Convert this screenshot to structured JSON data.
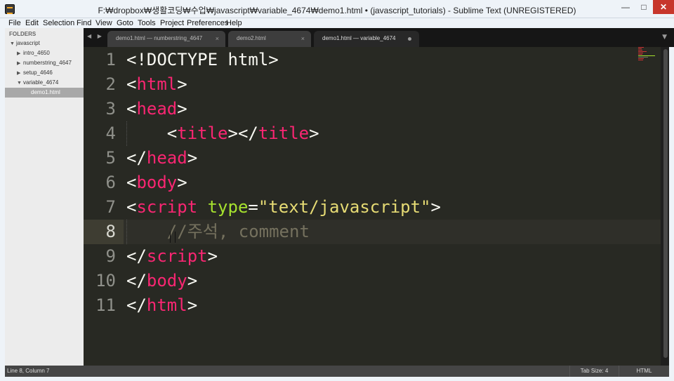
{
  "window": {
    "title": "F:₩dropbox₩생활코딩₩수업₩javascript₩variable_4674₩demo1.html • (javascript_tutorials) - Sublime Text (UNREGISTERED)",
    "minimize": "—",
    "maximize": "□",
    "close": "✕"
  },
  "menu": [
    "File",
    "Edit",
    "Selection",
    "Find",
    "View",
    "Goto",
    "Tools",
    "Project",
    "Preferences",
    "Help"
  ],
  "sidebar": {
    "header": "FOLDERS",
    "items": [
      {
        "label": "javascript",
        "expanded": true
      },
      {
        "label": "intro_4650",
        "expanded": false
      },
      {
        "label": "numberstring_4647",
        "expanded": false
      },
      {
        "label": "setup_4646",
        "expanded": false
      },
      {
        "label": "variable_4674",
        "expanded": true
      },
      {
        "label": "demo1.html",
        "selected": true
      }
    ]
  },
  "tabs": [
    {
      "label": "demo1.html — numberstring_4647",
      "active": false,
      "close": "×"
    },
    {
      "label": "demo2.html",
      "active": false,
      "close": "×"
    },
    {
      "label": "demo1.html — variable_4674",
      "active": true,
      "modified": true
    }
  ],
  "tab_nav": "◀ ▶",
  "tab_dropdown": "▼",
  "editor": {
    "current_line": 8,
    "lines": [
      {
        "n": "1",
        "tokens": [
          {
            "t": "<!DOCTYPE html>",
            "c": "plain"
          }
        ]
      },
      {
        "n": "2",
        "tokens": [
          {
            "t": "<",
            "c": "plain"
          },
          {
            "t": "html",
            "c": "tag"
          },
          {
            "t": ">",
            "c": "plain"
          }
        ]
      },
      {
        "n": "3",
        "tokens": [
          {
            "t": "<",
            "c": "plain"
          },
          {
            "t": "head",
            "c": "tag"
          },
          {
            "t": ">",
            "c": "plain"
          }
        ]
      },
      {
        "n": "4",
        "tokens": [
          {
            "t": "    <",
            "c": "plain"
          },
          {
            "t": "title",
            "c": "tag"
          },
          {
            "t": "></",
            "c": "plain"
          },
          {
            "t": "title",
            "c": "tag"
          },
          {
            "t": ">",
            "c": "plain"
          }
        ]
      },
      {
        "n": "5",
        "tokens": [
          {
            "t": "</",
            "c": "plain"
          },
          {
            "t": "head",
            "c": "tag"
          },
          {
            "t": ">",
            "c": "plain"
          }
        ]
      },
      {
        "n": "6",
        "tokens": [
          {
            "t": "<",
            "c": "plain"
          },
          {
            "t": "body",
            "c": "tag"
          },
          {
            "t": ">",
            "c": "plain"
          }
        ]
      },
      {
        "n": "7",
        "tokens": [
          {
            "t": "<",
            "c": "plain"
          },
          {
            "t": "script",
            "c": "tag"
          },
          {
            "t": " ",
            "c": "plain"
          },
          {
            "t": "type",
            "c": "attr"
          },
          {
            "t": "=",
            "c": "plain"
          },
          {
            "t": "\"text/javascript\"",
            "c": "str"
          },
          {
            "t": ">",
            "c": "plain"
          }
        ]
      },
      {
        "n": "8",
        "tokens": [
          {
            "t": "    //주석, comment",
            "c": "comment"
          }
        ]
      },
      {
        "n": "9",
        "tokens": [
          {
            "t": "</",
            "c": "plain"
          },
          {
            "t": "script",
            "c": "tag"
          },
          {
            "t": ">",
            "c": "plain"
          }
        ]
      },
      {
        "n": "10",
        "tokens": [
          {
            "t": "</",
            "c": "plain"
          },
          {
            "t": "body",
            "c": "tag"
          },
          {
            "t": ">",
            "c": "plain"
          }
        ]
      },
      {
        "n": "11",
        "tokens": [
          {
            "t": "</",
            "c": "plain"
          },
          {
            "t": "html",
            "c": "tag"
          },
          {
            "t": ">",
            "c": "plain"
          }
        ]
      }
    ]
  },
  "statusbar": {
    "position": "Line 8, Column 7",
    "tab_size": "Tab Size: 4",
    "syntax": "HTML"
  },
  "colors": {
    "tag": "#f92672",
    "attr": "#a6e22e",
    "string": "#e6db74",
    "comment": "#75715e",
    "background": "#282923"
  }
}
